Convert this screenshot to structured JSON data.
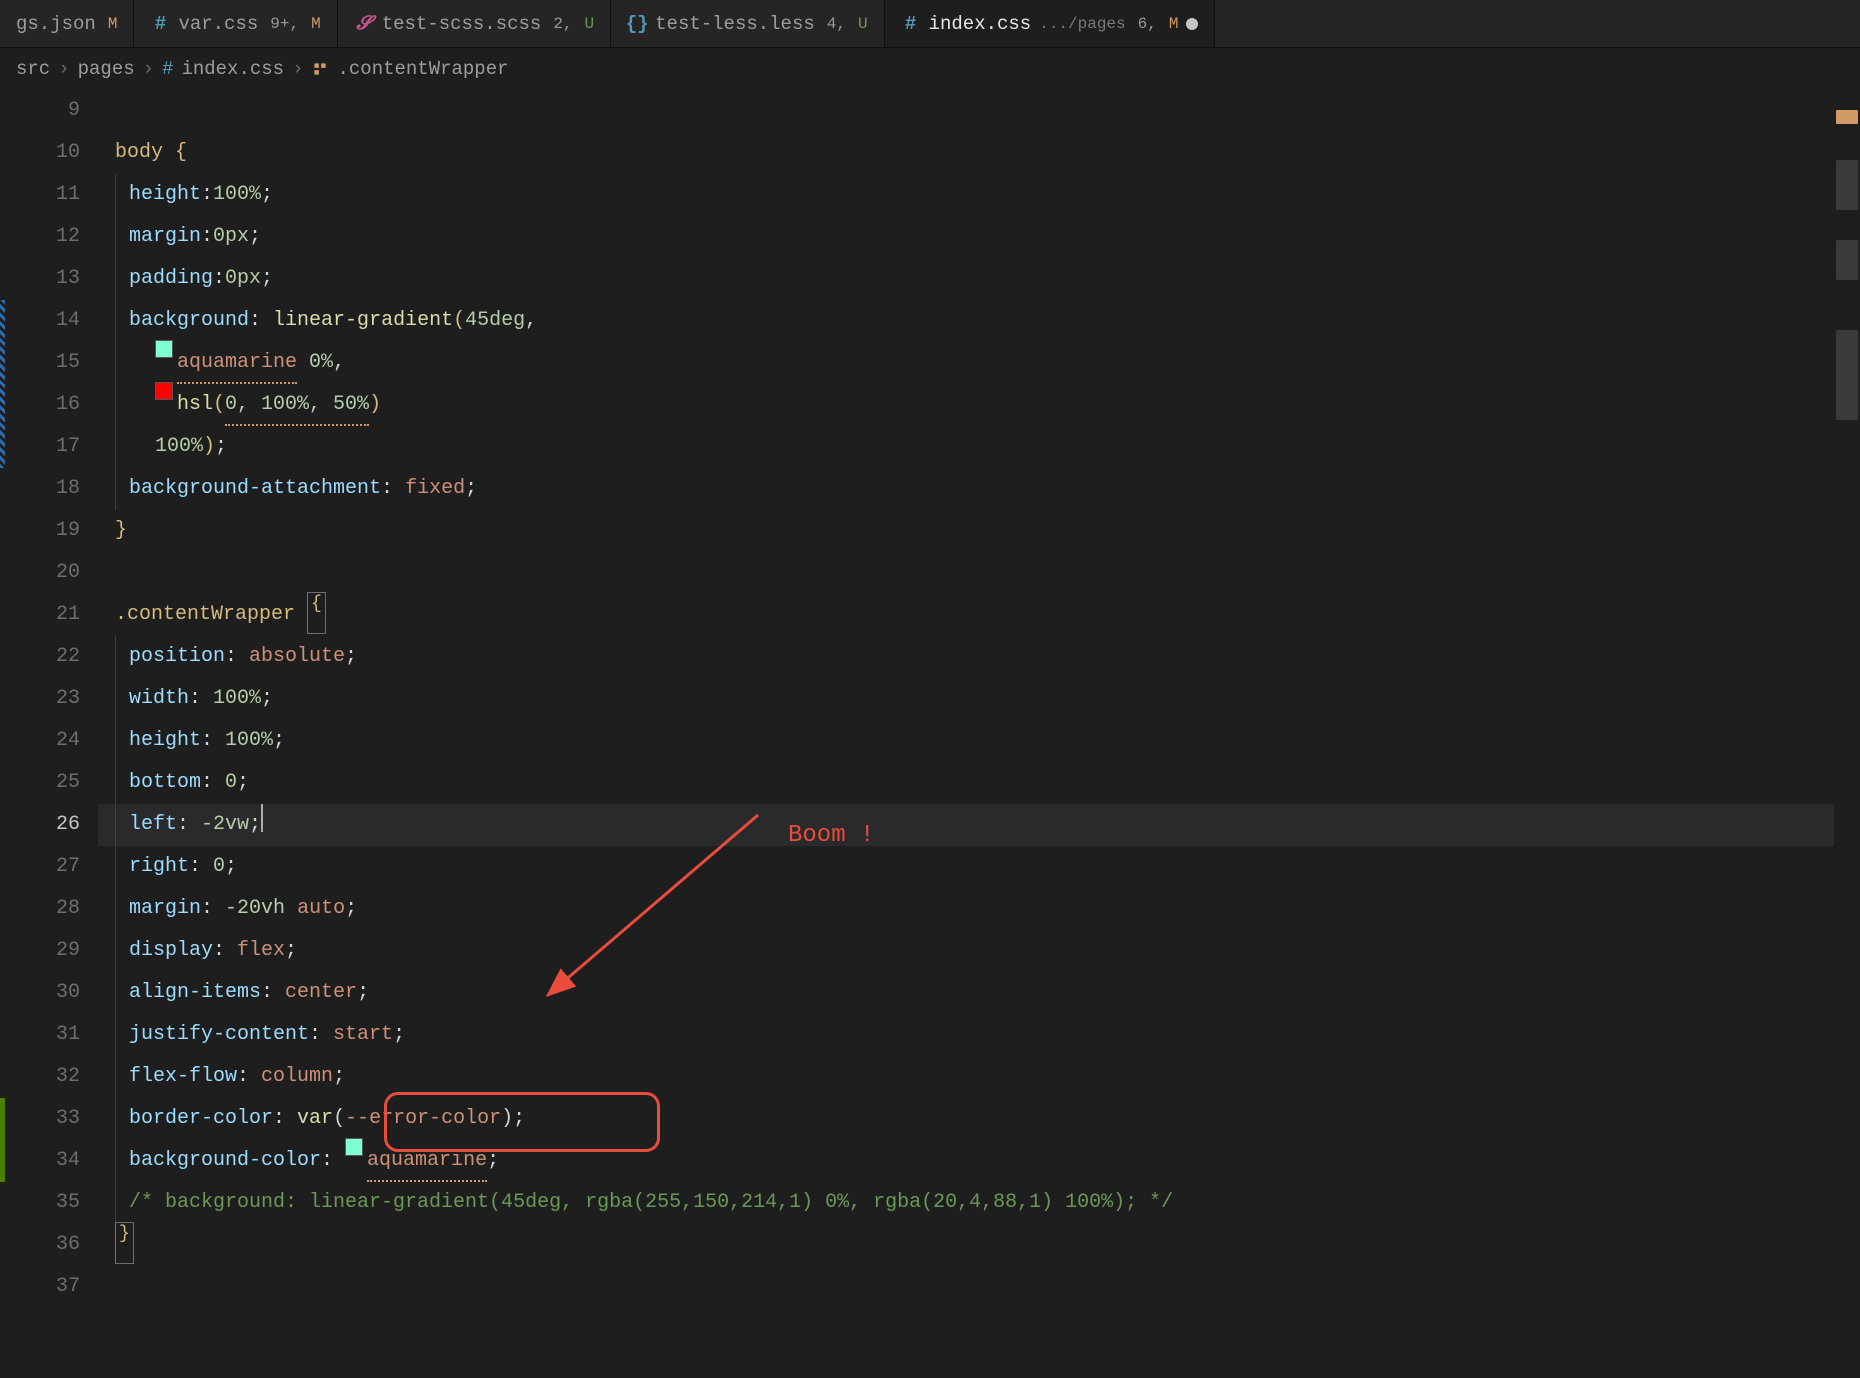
{
  "tabs": [
    {
      "icon": "braces",
      "iconColor": "#cccccc",
      "name": "gs.json",
      "status": "M",
      "statusClass": "m-badge"
    },
    {
      "icon": "hash",
      "iconColor": "#519aba",
      "name": "var.css",
      "diff": "9+,",
      "status": "M",
      "statusClass": "m-badge"
    },
    {
      "icon": "sass",
      "iconColor": "#c6538c",
      "name": "test-scss.scss",
      "diff": "2,",
      "status": "U",
      "statusClass": "u-badge"
    },
    {
      "icon": "braces",
      "iconColor": "#519aba",
      "name": "test-less.less",
      "diff": "4,",
      "status": "U",
      "statusClass": "u-badge"
    },
    {
      "icon": "hash",
      "iconColor": "#519aba",
      "name": "index.css",
      "folder": ".../pages",
      "diff": "6,",
      "status": "M",
      "statusClass": "m-badge",
      "active": true,
      "dirty": true
    }
  ],
  "breadcrumbs": {
    "parts": [
      "src",
      "pages"
    ],
    "fileIcon": "hash",
    "file": "index.css",
    "symbolIcon": "bracket-pair",
    "symbol": ".contentWrapper"
  },
  "lines_start": 9,
  "current_line": 26,
  "code": {
    "l10_sel": "body",
    "l11_prop": "height",
    "l11_val": "100%",
    "l12_prop": "margin",
    "l12_val": "0px",
    "l13_prop": "padding",
    "l13_val": "0px",
    "l14_prop": "background",
    "l14_func": "linear-gradient",
    "l14_arg": "45deg",
    "l15_name": "aquamarine",
    "l15_stop": "0%",
    "l16_func": "hsl",
    "l16_args": "0, 100%, 50%",
    "l17_stop": "100%",
    "l18_prop": "background-attachment",
    "l18_val": "fixed",
    "l21_sel": ".contentWrapper",
    "l22_prop": "position",
    "l22_val": "absolute",
    "l23_prop": "width",
    "l23_val": "100%",
    "l24_prop": "height",
    "l24_val": "100%",
    "l25_prop": "bottom",
    "l25_val": "0",
    "l26_prop": "left",
    "l26_val": "-2vw",
    "l27_prop": "right",
    "l27_val": "0",
    "l28_prop": "margin",
    "l28_val1": "-20vh",
    "l28_val2": "auto",
    "l29_prop": "display",
    "l29_val": "flex",
    "l30_prop": "align-items",
    "l30_val": "center",
    "l31_prop": "justify-content",
    "l31_val": "start",
    "l32_prop": "flex-flow",
    "l32_val": "column",
    "l33_prop": "border-color",
    "l33_func": "var",
    "l33_arg": "--error-color",
    "l34_prop": "background-color",
    "l34_val": "aquamarine",
    "l35_comment": "/* background: linear-gradient(45deg, rgba(255,150,214,1) 0%, rgba(20,4,88,1) 100%); */"
  },
  "annotation": {
    "text": "Boom !"
  }
}
